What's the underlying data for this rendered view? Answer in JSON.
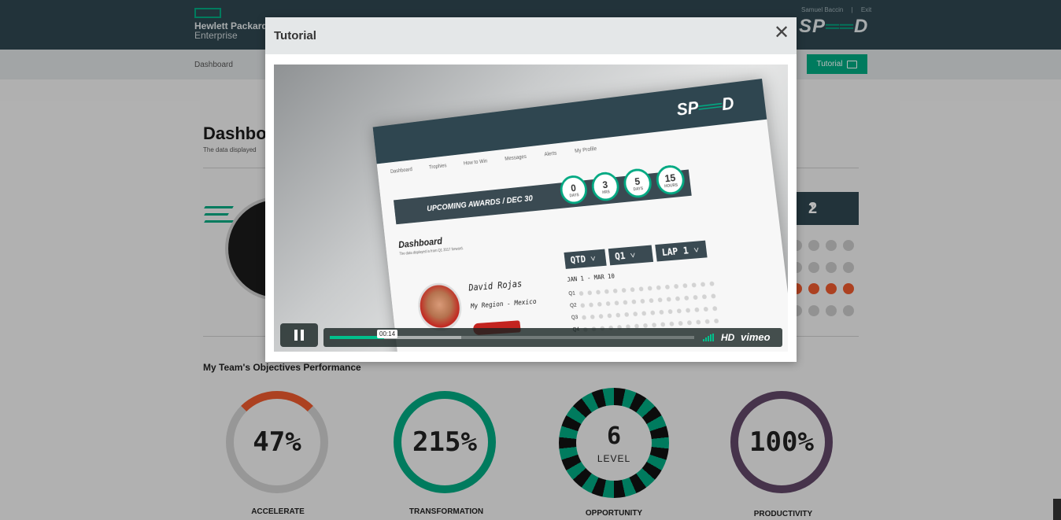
{
  "header": {
    "brand_line1": "Hewlett Packard",
    "brand_line2": "Enterprise",
    "user_name": "Samuel Baccin",
    "exit_label": "Exit",
    "speed_logo_sp": "SP",
    "speed_logo_ee": "══",
    "speed_logo_d": "D"
  },
  "nav": {
    "items": [
      "Dashboard"
    ],
    "tutorial_label": "Tutorial",
    "tutorial_icon": "video-camera-icon"
  },
  "page": {
    "title": "Dashbo",
    "subtitle": "The data displayed",
    "lap_value": "2",
    "section_title": "My Team's Objectives Performance",
    "gauges": [
      {
        "value": "47%",
        "label": "ACCELERATE",
        "color": "#ec5a2e"
      },
      {
        "value": "215%",
        "label": "TRANSFORMATION",
        "color": "#01a982"
      },
      {
        "value": "100%",
        "label": "PRODUCTIVITY",
        "color": "#614767"
      }
    ],
    "roulette": {
      "number": "6",
      "level_label": "LEVEL",
      "label": "OPPORTUNITY"
    }
  },
  "modal": {
    "title": "Tutorial",
    "close_icon": "close-icon",
    "video": {
      "mock_nav": [
        "Dashboard",
        "Trophies",
        "How to Win",
        "Messages",
        "Alerts",
        "My Profile"
      ],
      "award_text": "UPCOMING AWARDS / DEC 30",
      "countdown": [
        {
          "value": "0",
          "unit": "DAYS"
        },
        {
          "value": "3",
          "unit": "HRS"
        },
        {
          "value": "5",
          "unit": "DAYS"
        },
        {
          "value": "15",
          "unit": "HOURS"
        }
      ],
      "mock_title": "Dashboard",
      "mock_subtitle": "The data displayed is from Q1 2017 forward.",
      "driver_name": "David Rojas",
      "driver_region": "My Region - Mexico",
      "selectors": [
        "QTD ˅",
        "Q1 ˅",
        "LAP 1 ˅"
      ],
      "date_range": "JAN 1 - MAR 10",
      "quarters": [
        "Q1",
        "Q2",
        "Q3",
        "Q4"
      ],
      "timecode": "00:14",
      "progress": 0.15,
      "buffered": 0.36,
      "hd_label": "HD",
      "vimeo_label": "vimeo"
    }
  }
}
